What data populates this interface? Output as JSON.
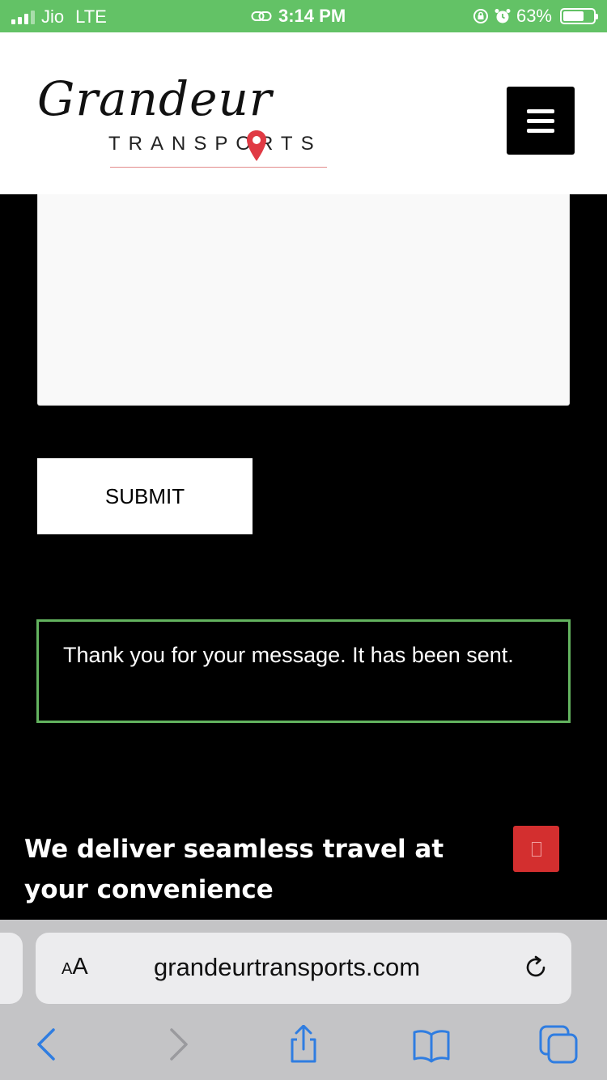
{
  "status_bar": {
    "carrier": "Jio",
    "network": "LTE",
    "time": "3:14 PM",
    "battery": "63%",
    "battery_level": 0.63,
    "background_color": "#63c266"
  },
  "header": {
    "logo_script": "Grandeur",
    "logo_sub": "TRANSPORTS",
    "menu_icon": "hamburger-menu-icon"
  },
  "form": {
    "message_value": "",
    "submit_label": "SUBMIT",
    "response_message": "Thank you for your message. It has been sent.",
    "response_border_color": "#63b35f"
  },
  "footer": {
    "tagline": "We deliver seamless travel at your convenience",
    "scroll_top_color": "#d32f2f"
  },
  "browser": {
    "aa_small": "A",
    "aa_large": "A",
    "url": "grandeurtransports.com",
    "accent_color": "#2f7de1",
    "icons": [
      "back-arrow-icon",
      "forward-arrow-icon",
      "share-icon",
      "bookmarks-icon",
      "tabs-icon",
      "reload-icon"
    ]
  }
}
